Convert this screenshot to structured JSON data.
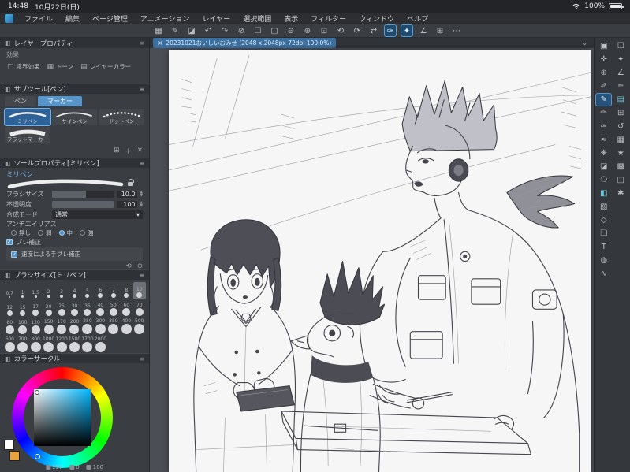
{
  "status_bar": {
    "time": "14:48",
    "date": "10月22日(日)",
    "battery_percent": "100%"
  },
  "menu_bar": {
    "items": [
      "ファイル",
      "編集",
      "ページ管理",
      "アニメーション",
      "レイヤー",
      "選択範囲",
      "表示",
      "フィルター",
      "ウィンドウ",
      "ヘルプ"
    ]
  },
  "toolbar": {
    "icons": [
      {
        "name": "workspace-grid-icon",
        "glyph": "▦",
        "active": false
      },
      {
        "name": "pen-quick-icon",
        "glyph": "✎",
        "active": false
      },
      {
        "name": "eraser-quick-icon",
        "glyph": "◪",
        "active": false
      },
      {
        "name": "undo-icon",
        "glyph": "↶",
        "active": false
      },
      {
        "name": "redo-icon",
        "glyph": "↷",
        "active": false
      },
      {
        "name": "clear-icon",
        "glyph": "⊘",
        "active": false
      },
      {
        "name": "selection-icon",
        "glyph": "☐",
        "active": false
      },
      {
        "name": "deselect-icon",
        "glyph": "▢",
        "active": false
      },
      {
        "name": "zoom-out-icon",
        "glyph": "⊖",
        "active": false
      },
      {
        "name": "zoom-in-icon",
        "glyph": "⊕",
        "active": false
      },
      {
        "name": "fit-screen-icon",
        "glyph": "⊡",
        "active": false
      },
      {
        "name": "rotate-left-icon",
        "glyph": "⟲",
        "active": false
      },
      {
        "name": "rotate-right-icon",
        "glyph": "⟳",
        "active": false
      },
      {
        "name": "flip-horizontal-icon",
        "glyph": "⇄",
        "active": false
      },
      {
        "name": "pen-mode-icon",
        "glyph": "✑",
        "active": true
      },
      {
        "name": "brush-mode-icon",
        "glyph": "✦",
        "active": true
      },
      {
        "name": "snap-ruler-icon",
        "glyph": "∠",
        "active": false
      },
      {
        "name": "grid-snap-icon",
        "glyph": "⊞",
        "active": false
      },
      {
        "name": "more-options-icon",
        "glyph": "⋯",
        "active": false
      }
    ]
  },
  "document_tab": {
    "close": "×",
    "title": "20231021おいしいおみせ (2048 x 2048px 72dpi 100.0%)",
    "chevron": "⌄"
  },
  "panel_header": {
    "left_glyph": "◧",
    "menu_glyph": "≡",
    "collapse_glyph": "▴"
  },
  "left_panel": {
    "layer_property": {
      "title": "レイヤープロパティ",
      "effect_label": "効果",
      "effects": [
        {
          "name": "border-effect-button",
          "glyph": "▢",
          "label": "境界効果"
        },
        {
          "name": "tone-effect-button",
          "glyph": "▦",
          "label": "トーン"
        },
        {
          "name": "layer-color-effect-button",
          "glyph": "▤",
          "label": "レイヤーカラー"
        }
      ]
    },
    "subtool": {
      "title": "サブツール[ペン]",
      "tabs": [
        {
          "label": "ペン",
          "active": false
        },
        {
          "label": "マーカー",
          "active": true
        }
      ],
      "items": [
        {
          "label": "ミリペン",
          "selected": true,
          "stroke": "taper"
        },
        {
          "label": "サインペン",
          "selected": false,
          "stroke": "sign"
        },
        {
          "label": "ドットペン",
          "selected": false,
          "stroke": "dot"
        },
        {
          "label": "フラットマーカー",
          "selected": false,
          "stroke": "flat"
        }
      ],
      "footer_icons": [
        {
          "name": "duplicate-subtool-icon",
          "glyph": "⊞"
        },
        {
          "name": "add-subtool-icon",
          "glyph": "＋"
        },
        {
          "name": "delete-subtool-icon",
          "glyph": "✕"
        }
      ]
    },
    "tool_property": {
      "title": "ツールプロパティ[ミリペン]",
      "tool_name": "ミリペン",
      "rows": {
        "brush_size": {
          "label": "ブラシサイズ",
          "value": "10.0",
          "fill": 0.55
        },
        "opacity": {
          "label": "不透明度",
          "value": "100",
          "fill": 1
        },
        "blend": {
          "label": "合成モード",
          "value": "通常"
        },
        "antialias": {
          "label": "アンチエイリアス",
          "options": [
            {
              "label": "無し",
              "selected": false
            },
            {
              "label": "弱",
              "selected": false
            },
            {
              "label": "中",
              "selected": true
            },
            {
              "label": "強",
              "selected": false
            }
          ]
        },
        "stabilize": {
          "label": "ブレ補正",
          "checked": true
        },
        "speed_stabilize": {
          "label": "速度による手ブレ補正",
          "checked": true
        }
      },
      "footer_icons": [
        {
          "name": "reset-property-icon",
          "glyph": "⟲"
        },
        {
          "name": "add-property-icon",
          "glyph": "⊕"
        }
      ]
    },
    "brush_sizes": {
      "title": "ブラシサイズ[ミリペン]",
      "selected": "10",
      "sizes": [
        "0.7",
        "1",
        "1.5",
        "2",
        "3",
        "4",
        "5",
        "6",
        "7",
        "8",
        "10",
        "12",
        "15",
        "17",
        "20",
        "25",
        "30",
        "35",
        "40",
        "50",
        "60",
        "70",
        "80",
        "100",
        "120",
        "150",
        "170",
        "200",
        "250",
        "300",
        "350",
        "400",
        "500",
        "600",
        "700",
        "800",
        "1000",
        "1200",
        "1500",
        "1700",
        "2000"
      ]
    },
    "color_circle": {
      "title": "カラーサークル",
      "hsv": [
        {
          "name": "hue-value",
          "value": "197"
        },
        {
          "name": "saturation-value",
          "value": "0"
        },
        {
          "name": "brightness-value",
          "value": "100"
        }
      ],
      "main_color": "#ffffff",
      "sub_color": "#e8a33d",
      "hue_color": "#00b7ff"
    }
  },
  "right_toolbar": {
    "primary": [
      {
        "name": "operation-tool-icon",
        "glyph": "▣"
      },
      {
        "name": "move-tool-icon",
        "glyph": "✛"
      },
      {
        "name": "zoom-tool-icon",
        "glyph": "⊕"
      },
      {
        "name": "eyedropper-tool-icon",
        "glyph": "✐"
      },
      {
        "name": "pen-tool-icon",
        "glyph": "✎",
        "active": true
      },
      {
        "name": "pencil-tool-icon",
        "glyph": "✏"
      },
      {
        "name": "brush-tool-icon",
        "glyph": "✑"
      },
      {
        "name": "airbrush-tool-icon",
        "glyph": "≈"
      },
      {
        "name": "decoration-tool-icon",
        "glyph": "❋"
      },
      {
        "name": "eraser-tool-icon",
        "glyph": "◪"
      },
      {
        "name": "blend-tool-icon",
        "glyph": "❍"
      },
      {
        "name": "fill-tool-icon",
        "glyph": "◧",
        "teal": true
      },
      {
        "name": "gradient-tool-icon",
        "glyph": "▨"
      },
      {
        "name": "figure-tool-icon",
        "glyph": "◇"
      },
      {
        "name": "frame-border-tool-icon",
        "glyph": "❏"
      },
      {
        "name": "text-tool-icon",
        "glyph": "T"
      },
      {
        "name": "balloon-tool-icon",
        "glyph": "◍"
      },
      {
        "name": "line-correct-tool-icon",
        "glyph": "∿"
      }
    ],
    "secondary": [
      {
        "name": "selection-area-icon",
        "glyph": "☐"
      },
      {
        "name": "auto-select-icon",
        "glyph": "✦"
      },
      {
        "name": "ruler-icon",
        "glyph": "∠"
      },
      {
        "name": "timeline-icon",
        "glyph": "≡"
      },
      {
        "name": "layer-panel-icon",
        "glyph": "▤",
        "teal": true
      },
      {
        "name": "navigator-icon",
        "glyph": "⊞"
      },
      {
        "name": "history-icon",
        "glyph": "↺"
      },
      {
        "name": "material-icon",
        "glyph": "▦"
      },
      {
        "name": "quick-access-icon",
        "glyph": "★"
      },
      {
        "name": "color-set-icon",
        "glyph": "▩"
      },
      {
        "name": "sub-view-icon",
        "glyph": "◫"
      },
      {
        "name": "settings-icon",
        "glyph": "✱"
      }
    ]
  },
  "colors": {
    "accent": "#5795c8",
    "canvas_bg": "#4b4e55",
    "panel_bg": "#3a3d42"
  }
}
